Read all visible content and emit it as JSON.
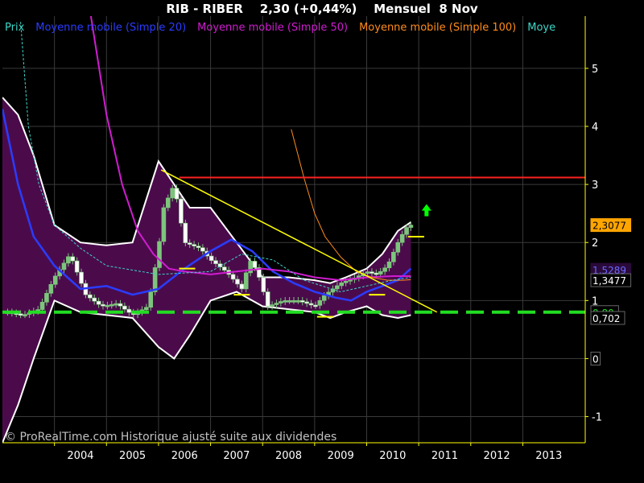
{
  "header": {
    "title": "RIB - RIBER    2,30 (+0,44%)    Mensuel  8 Nov"
  },
  "footer": {
    "credit": "© ProRealTime.com Historique ajusté suite aux dividendes"
  },
  "colors": {
    "background": "#000000",
    "plot_border": "#ffff00",
    "grid": "#3a3a3a",
    "bollinger_fill": "#4b0b4b",
    "bollinger_edge": "#ffffff",
    "sma20": "#2a3cff",
    "sma50": "#d01cd0",
    "sma100": "#ff8c1a",
    "sma200": "#3dd6c8",
    "resistance": "#ff2222",
    "trendline": "#ffff00",
    "support": "#22dd22",
    "candle": "#7cc57c",
    "arrow": "#00ff00"
  },
  "chart_data": {
    "type": "candlestick",
    "title": "RIB - RIBER    2,30 (+0,44%)    Mensuel  8 Nov",
    "x_axis": {
      "ticks": [
        "2004",
        "2005",
        "2006",
        "2007",
        "2008",
        "2009",
        "2010",
        "2011",
        "2012",
        "2013"
      ],
      "range": [
        2003.0,
        2014.2
      ]
    },
    "y_axis": {
      "ticks": [
        "5",
        "4",
        "3",
        "2",
        "1",
        "0",
        "-1"
      ],
      "tick_values": [
        5,
        4,
        3,
        2,
        1,
        0,
        -1
      ],
      "range": [
        -1.45,
        5.9
      ],
      "side": "right"
    },
    "grid": true,
    "legend": {
      "placement": "top",
      "entries": [
        {
          "label": "Prix",
          "color": "#3dd6c8"
        },
        {
          "label": "Moyenne mobile (Simple 20)",
          "color": "#2a3cff"
        },
        {
          "label": "Moyenne mobile (Simple 50)",
          "color": "#d01cd0"
        },
        {
          "label": "Moyenne mobile (Simple 100)",
          "color": "#ff8c1a"
        },
        {
          "label": "Moye",
          "color": "#3dd6c8"
        }
      ]
    },
    "price_tags": [
      {
        "text": "2,3077",
        "value": 2.3,
        "bg": "#ffa500",
        "fg": "#000000"
      },
      {
        "text": "1,5289",
        "value": 1.53,
        "bg": "#2a0a3a",
        "fg": "#6a6aff"
      },
      {
        "text": "1,3477",
        "value": 1.35,
        "bg": "#000000",
        "fg": "#ffffff"
      },
      {
        "text": "0,80",
        "value": 0.8,
        "bg": "#000000",
        "fg": "#22dd22"
      },
      {
        "text": "0,702",
        "value": 0.7,
        "bg": "#000000",
        "fg": "#ffffff"
      },
      {
        "text": "0",
        "value": 0.0,
        "bg": "#000000",
        "fg": "#ffffff"
      }
    ],
    "price": {
      "x": [
        2003.1,
        2003.4,
        2003.7,
        2004.0,
        2004.3,
        2004.6,
        2004.9,
        2005.2,
        2005.5,
        2005.8,
        2006.0,
        2006.1,
        2006.3,
        2006.5,
        2006.8,
        2007.0,
        2007.3,
        2007.6,
        2007.75,
        2007.9,
        2008.1,
        2008.4,
        2008.7,
        2009.0,
        2009.2,
        2009.5,
        2009.8,
        2010.0,
        2010.2,
        2010.4,
        2010.6,
        2010.75,
        2010.85
      ],
      "y": [
        0.8,
        0.75,
        0.85,
        1.4,
        1.8,
        1.1,
        0.9,
        0.95,
        0.75,
        0.9,
        1.9,
        2.6,
        3.0,
        2.0,
        1.9,
        1.7,
        1.5,
        1.2,
        1.7,
        1.5,
        0.9,
        1.0,
        1.0,
        0.9,
        1.1,
        1.3,
        1.4,
        1.5,
        1.45,
        1.6,
        2.0,
        2.25,
        2.3
      ]
    },
    "series": [
      {
        "name": "Moyenne mobile (Simple 20)",
        "x": [
          2003.0,
          2003.3,
          2003.6,
          2004.0,
          2004.5,
          2005.0,
          2005.5,
          2006.0,
          2006.5,
          2007.0,
          2007.4,
          2007.8,
          2008.2,
          2008.6,
          2009.0,
          2009.4,
          2009.7,
          2010.0,
          2010.3,
          2010.6,
          2010.85
        ],
        "y": [
          4.3,
          3.0,
          2.1,
          1.6,
          1.2,
          1.25,
          1.1,
          1.2,
          1.55,
          1.85,
          2.05,
          1.85,
          1.5,
          1.3,
          1.15,
          1.05,
          1.0,
          1.15,
          1.25,
          1.35,
          1.55
        ]
      },
      {
        "name": "Moyenne mobile (Simple 50)",
        "x": [
          2004.7,
          2005.0,
          2005.3,
          2005.6,
          2005.9,
          2006.2,
          2006.5,
          2007.0,
          2007.5,
          2008.0,
          2008.5,
          2009.0,
          2009.5,
          2010.0,
          2010.5,
          2010.85
        ],
        "y": [
          5.9,
          4.2,
          3.0,
          2.2,
          1.8,
          1.55,
          1.5,
          1.45,
          1.5,
          1.55,
          1.5,
          1.4,
          1.35,
          1.4,
          1.42,
          1.42
        ]
      },
      {
        "name": "Moyenne mobile (Simple 100)",
        "x": [
          2008.55,
          2008.8,
          2009.0,
          2009.2,
          2009.5,
          2009.8,
          2010.1,
          2010.4,
          2010.7,
          2010.85
        ],
        "y": [
          3.95,
          3.1,
          2.5,
          2.1,
          1.75,
          1.5,
          1.4,
          1.35,
          1.35,
          1.36
        ]
      },
      {
        "name": "Prix",
        "x": [
          2003.35,
          2003.5,
          2003.7,
          2004.0,
          2004.5,
          2005.0,
          2006.0,
          2007.0,
          2007.6,
          2008.2,
          2008.8,
          2009.5,
          2010.0,
          2010.5,
          2010.85
        ],
        "y": [
          5.8,
          4.0,
          3.0,
          2.3,
          1.9,
          1.6,
          1.45,
          1.5,
          1.8,
          1.7,
          1.35,
          1.15,
          1.25,
          1.35,
          1.4
        ]
      }
    ],
    "bollinger": {
      "x": [
        2003.0,
        2003.3,
        2003.6,
        2004.0,
        2004.5,
        2005.0,
        2005.5,
        2006.0,
        2006.3,
        2006.6,
        2007.0,
        2007.5,
        2008.0,
        2008.5,
        2009.0,
        2009.3,
        2009.6,
        2010.0,
        2010.3,
        2010.6,
        2010.85
      ],
      "upper": [
        4.5,
        4.2,
        3.5,
        2.3,
        2.0,
        1.95,
        2.0,
        3.4,
        3.0,
        2.6,
        2.6,
        2.0,
        1.4,
        1.4,
        1.35,
        1.3,
        1.4,
        1.55,
        1.8,
        2.2,
        2.35
      ],
      "lower": [
        -1.45,
        -0.8,
        0.0,
        1.0,
        0.8,
        0.75,
        0.7,
        0.2,
        0.0,
        0.4,
        1.0,
        1.15,
        0.9,
        0.85,
        0.8,
        0.7,
        0.8,
        0.9,
        0.75,
        0.7,
        0.75
      ]
    },
    "levels": [
      {
        "name": "resistance",
        "value": 3.12,
        "x_from": 2006.4,
        "x_to": 2014.2,
        "style": "solid"
      },
      {
        "name": "support",
        "value": 0.8,
        "x_from": 2003.0,
        "x_to": 2014.2,
        "style": "dashed"
      }
    ],
    "trendline": {
      "x": [
        2006.05,
        2011.35
      ],
      "y": [
        3.25,
        0.8
      ]
    },
    "markers": [
      {
        "x": 2006.55,
        "value": 1.55
      },
      {
        "x": 2007.6,
        "value": 1.1
      },
      {
        "x": 2009.2,
        "value": 0.72
      },
      {
        "x": 2010.2,
        "value": 1.1
      },
      {
        "x": 2010.95,
        "value": 2.1
      }
    ],
    "arrow": {
      "x": 2011.15,
      "value": 2.55
    }
  }
}
